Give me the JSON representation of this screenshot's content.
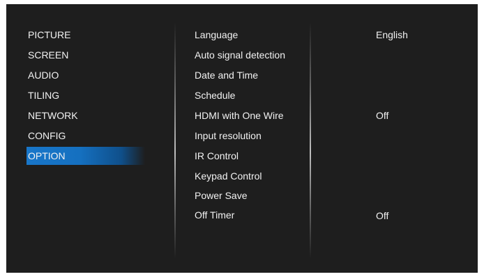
{
  "left_menu": {
    "items": [
      {
        "label": "PICTURE",
        "selected": false
      },
      {
        "label": "SCREEN",
        "selected": false
      },
      {
        "label": "AUDIO",
        "selected": false
      },
      {
        "label": "TILING",
        "selected": false
      },
      {
        "label": "NETWORK",
        "selected": false
      },
      {
        "label": "CONFIG",
        "selected": false
      },
      {
        "label": "OPTION",
        "selected": true
      }
    ]
  },
  "option_menu": {
    "items": [
      {
        "label": "Language",
        "value": "English"
      },
      {
        "label": "Auto signal detection",
        "value": ""
      },
      {
        "label": "Date and Time",
        "value": ""
      },
      {
        "label": "Schedule",
        "value": ""
      },
      {
        "label": "HDMI with One Wire",
        "value": "Off"
      },
      {
        "label": "Input resolution",
        "value": ""
      },
      {
        "label": "IR Control",
        "value": ""
      },
      {
        "label": "Keypad Control",
        "value": ""
      },
      {
        "label": "Power Save",
        "value": ""
      },
      {
        "label": "Off Timer",
        "value": "Off"
      }
    ]
  },
  "colors": {
    "background": "#1e1e1e",
    "text": "#f2f2f2",
    "selection_highlight": "#1876c9"
  }
}
